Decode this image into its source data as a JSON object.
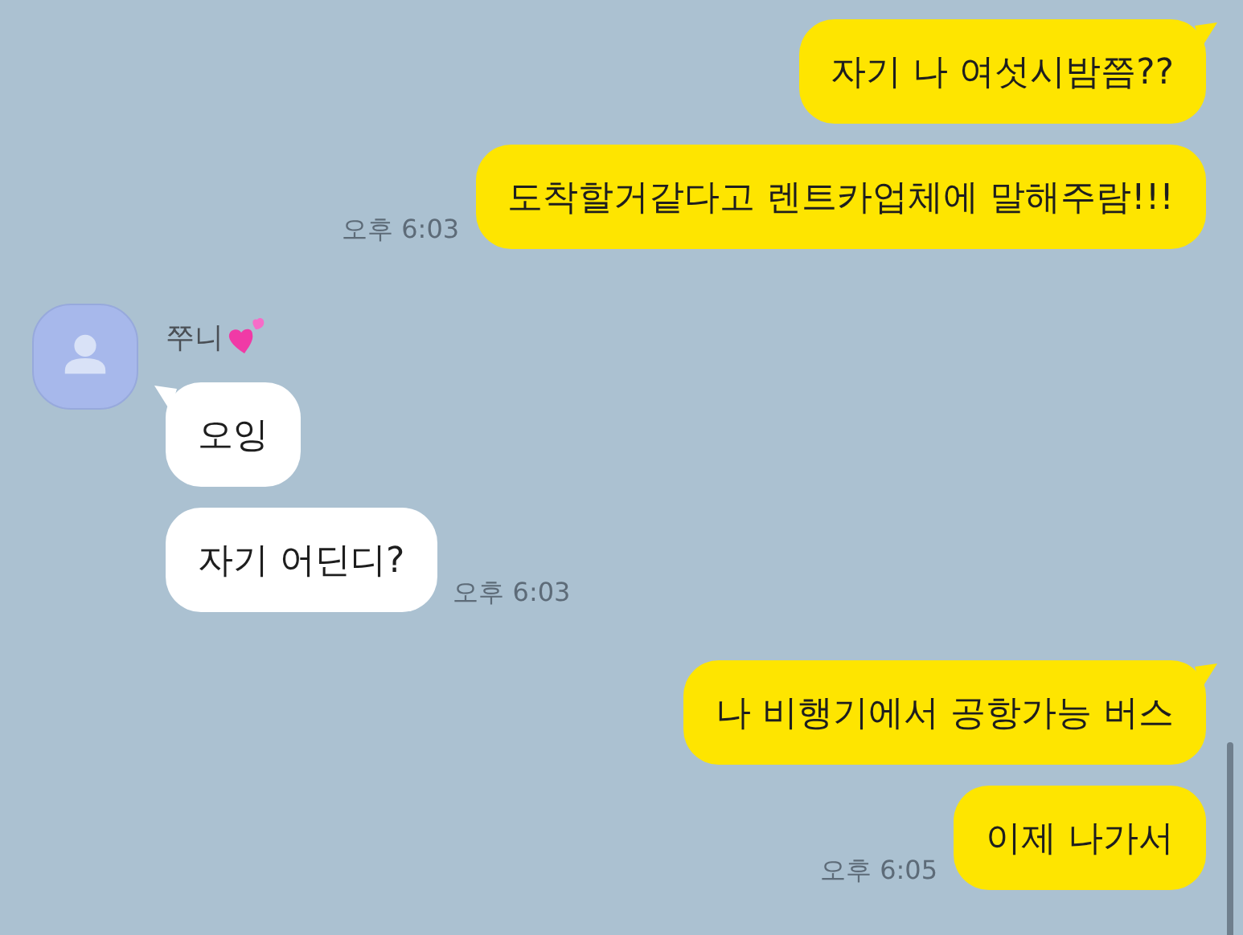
{
  "groups": [
    {
      "kind": "sent",
      "messages": [
        {
          "text": "자기 나 여섯시밤쯤??"
        },
        {
          "text": "도착할거같다고 렌트카업체에 말해주람!!!",
          "time": "오후 6:03"
        }
      ]
    },
    {
      "kind": "received",
      "sender": {
        "name": "쭈니"
      },
      "messages": [
        {
          "text": "오잉"
        },
        {
          "text": "자기 어딘디?",
          "time": "오후 6:03"
        }
      ]
    },
    {
      "kind": "sent",
      "messages": [
        {
          "text": "나 비행기에서 공항가능 버스"
        },
        {
          "text": "이제 나가서",
          "time": "오후 6:05"
        }
      ]
    }
  ]
}
